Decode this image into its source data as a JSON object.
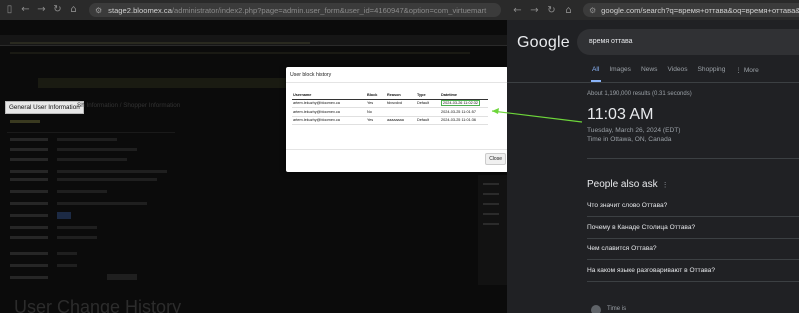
{
  "left_browser": {
    "url_host": "stage2.bloomex.ca",
    "url_path": "/administrator/index2.php?page=admin.user_form&user_id=4160947&option=com_virtuemart"
  },
  "admin": {
    "tab_general": "General User Information",
    "tab_second": "Sh Information / Shopper Information",
    "page_heading": "User Change History"
  },
  "modal": {
    "title": "User block history",
    "columns": [
      "Username",
      "Block",
      "Reason",
      "Type",
      "Datetime"
    ],
    "rows": [
      {
        "username": "artem.lekuzhy@bloomex.ca",
        "block": "Yes",
        "reason": "fdvsvdvd",
        "type": "Default",
        "datetime": "2024-03-26 11:02:32"
      },
      {
        "username": "artem.lekuzhy@bloomex.ca",
        "block": "No",
        "reason": "",
        "type": "",
        "datetime": "2024-03-25 11:01:57"
      },
      {
        "username": "artem.lekuzhy@bloomex.ca",
        "block": "Yes",
        "reason": "aaaaaaaa",
        "type": "Default",
        "datetime": "2024-03-25 11:01:36"
      }
    ],
    "close_label": "Close"
  },
  "right_browser": {
    "url": "google.com/search?q=время+оттава&oq=время+оттава&gs_lcrp=Eg"
  },
  "google": {
    "logo": "Google",
    "query": "время оттава",
    "tabs": [
      "All",
      "Images",
      "News",
      "Videos",
      "Shopping",
      "More"
    ],
    "results_count": "About 1,190,000 results (0.31 seconds)",
    "time": "11:03 AM",
    "date": "Tuesday, March 26, 2024 (EDT)",
    "place": "Time in Ottawa, ON, Canada",
    "paa_title": "People also ask",
    "paa": [
      "Что значит слово Оттава?",
      "Почему в Канаде Столица Оттава?",
      "Чем славится Оттава?",
      "На каком языке разговаривают в Оттава?"
    ],
    "bottom_text": "Time is"
  },
  "colors": {
    "annotation_arrow": "#6dd63a",
    "google_accent": "#8ab4f8",
    "google_bg": "#202124"
  }
}
